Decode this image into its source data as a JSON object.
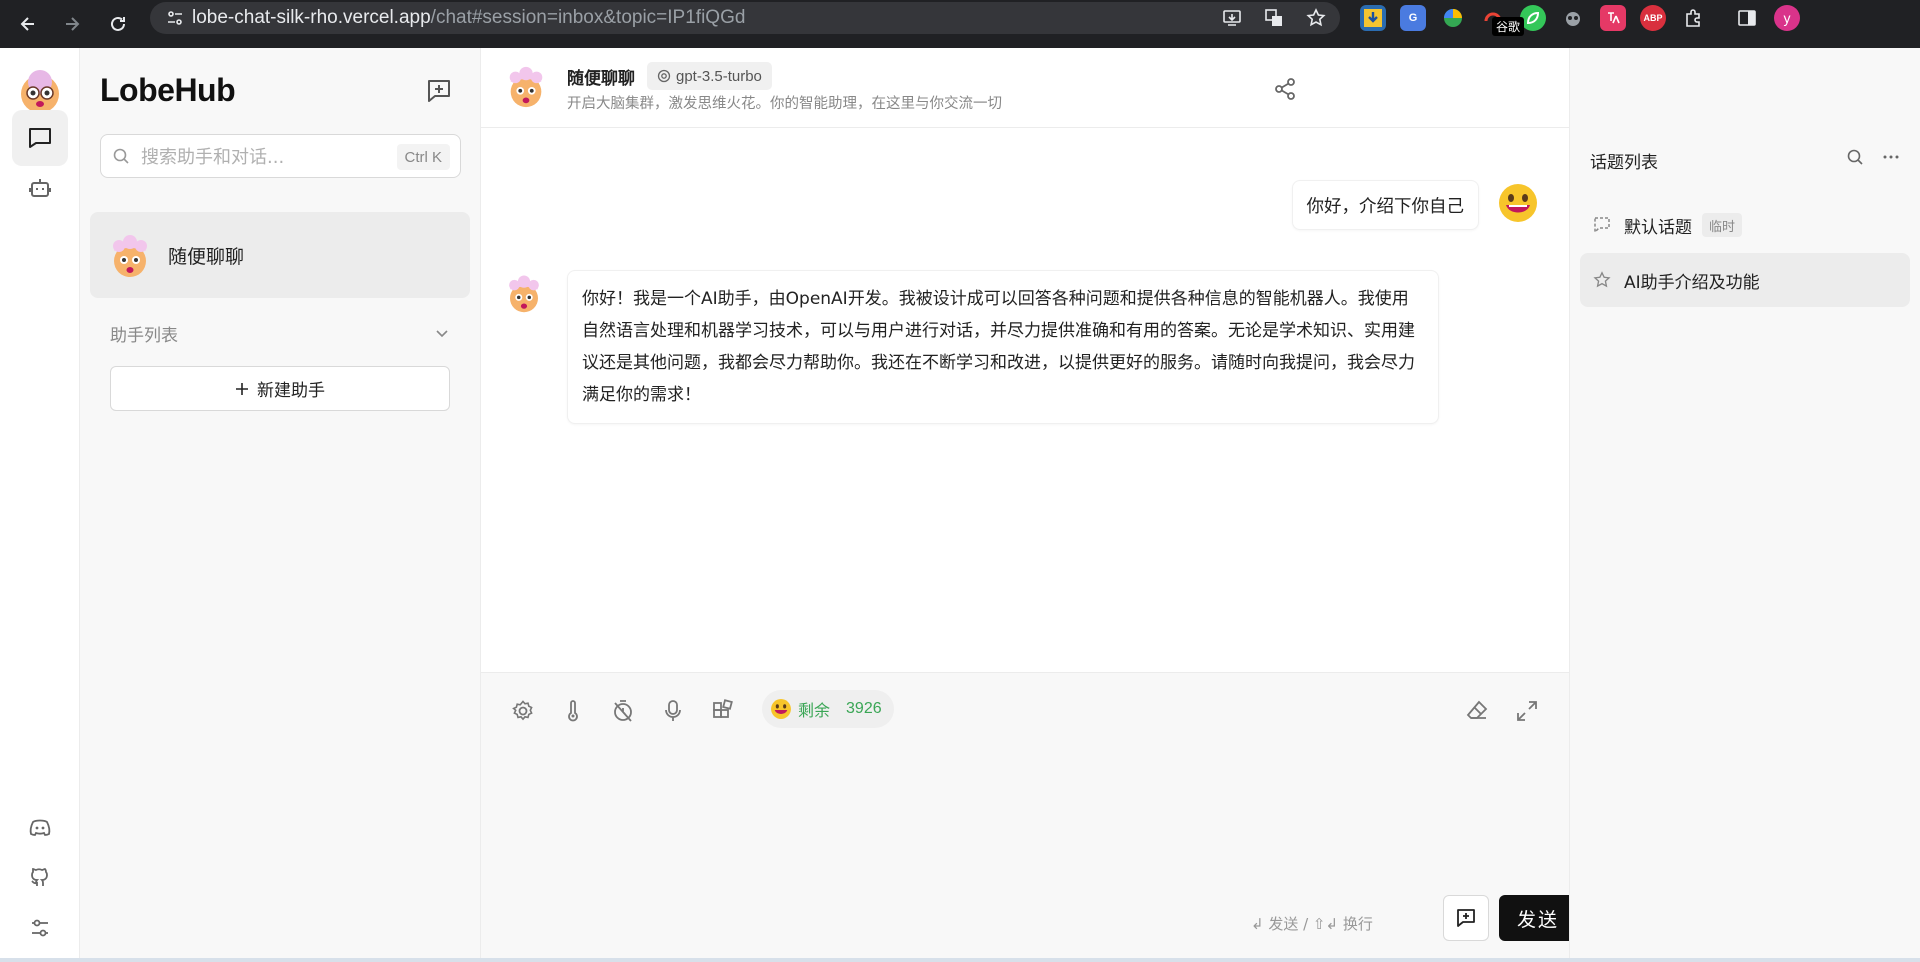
{
  "browser": {
    "url_host": "lobe-chat-silk-rho.vercel.app",
    "url_path": "/chat#session=inbox&topic=IP1fiQGd",
    "ext_label": "谷歌",
    "ext_abp": "ABP",
    "ext_g": "G",
    "profile_initial": "y"
  },
  "sidebar": {
    "brand": "LobeHub",
    "search_placeholder": "搜索助手和对话...",
    "search_shortcut": "Ctrl K",
    "session_title": "随便聊聊",
    "group_label": "助手列表",
    "new_agent_label": "新建助手"
  },
  "chat": {
    "title": "随便聊聊",
    "model": "gpt-3.5-turbo",
    "description": "开启大脑集群，激发思维火花。你的智能助理，在这里与你交流一切",
    "user_message": "你好，介绍下你自己",
    "ai_message": "你好！我是一个AI助手，由OpenAI开发。我被设计成可以回答各种问题和提供各种信息的智能机器人。我使用自然语言处理和机器学习技术，可以与用户进行对话，并尽力提供准确和有用的答案。无论是学术知识、实用建议还是其他问题，我都会尽力帮助你。我还在不断学习和改进，以提供更好的服务。请随时向我提问，我会尽力满足你的需求！"
  },
  "composer": {
    "token_label": "剩余",
    "token_count": "3926",
    "send_hint": "↲ 发送 / ⇧↲ 换行",
    "send_label": "发送"
  },
  "topics": {
    "title": "话题列表",
    "items": [
      {
        "label": "默认话题",
        "tag": "临时"
      },
      {
        "label": "AI助手介绍及功能"
      }
    ]
  },
  "colors": {
    "accent_dark": "#111111",
    "token_green": "#3aa655",
    "panel_bg": "#f8f8f8"
  }
}
